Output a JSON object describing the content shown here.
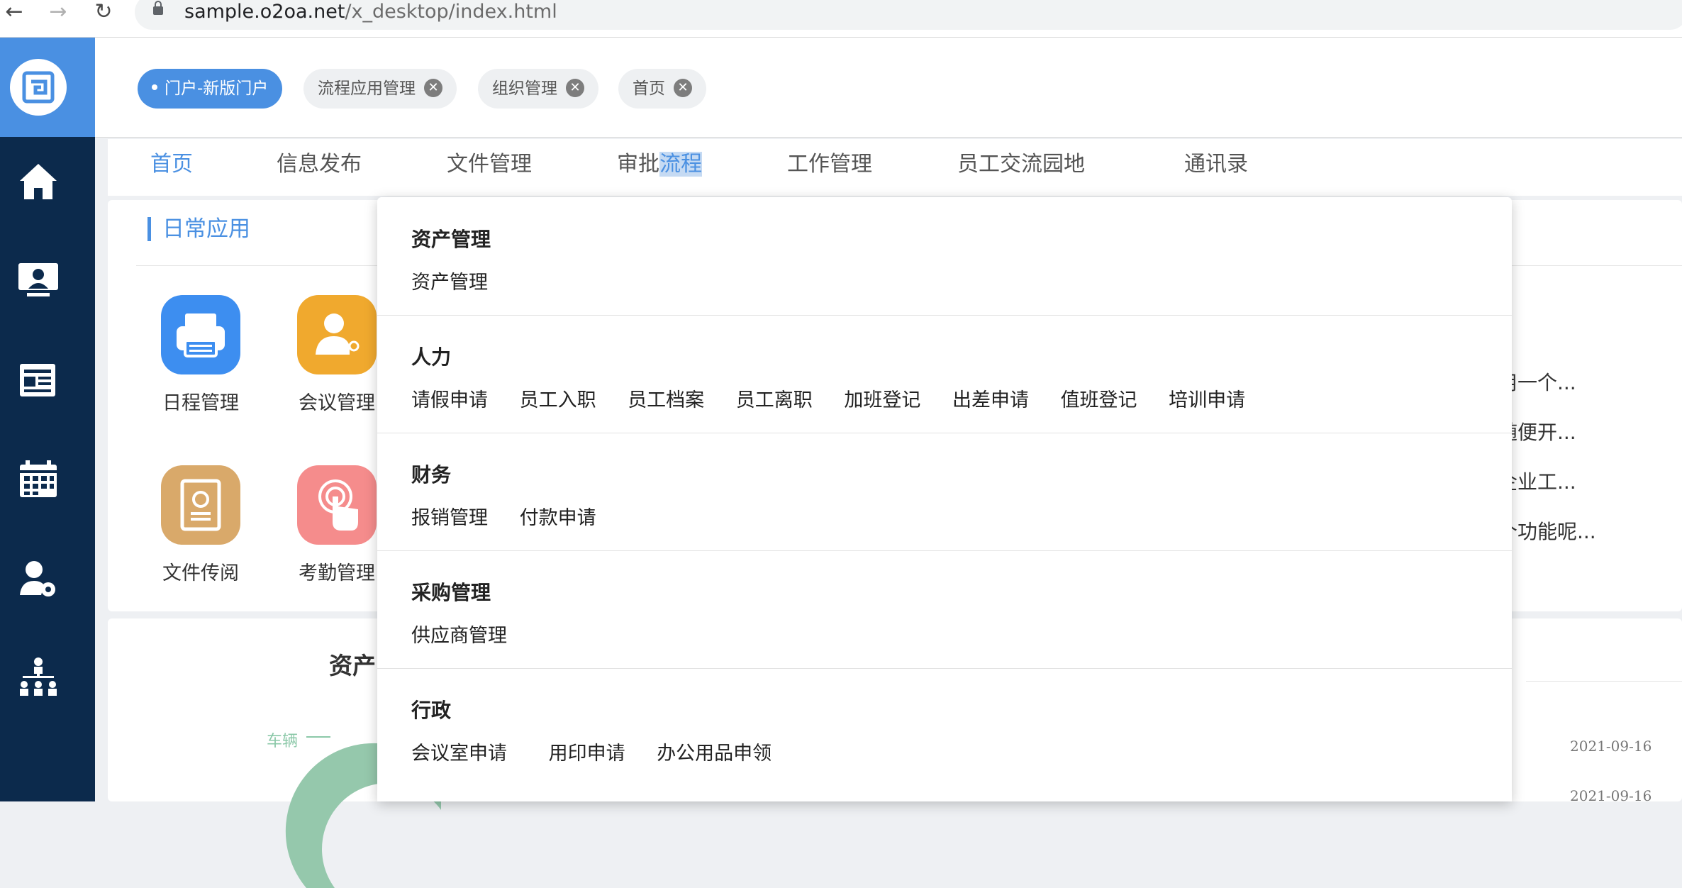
{
  "browser": {
    "back_icon": "←",
    "forward_icon": "→",
    "reload_icon": "↻",
    "url_host": "sample.o2oa.net",
    "url_path": "/x_desktop/index.html"
  },
  "sidebar": {
    "icons": [
      "logo-icon",
      "home-icon",
      "monitor-user-icon",
      "news-icon",
      "calendar-icon",
      "user-settings-icon",
      "org-chart-icon"
    ]
  },
  "tabs": [
    {
      "label": "门户-新版门户",
      "active": true
    },
    {
      "label": "流程应用管理",
      "close": "✕"
    },
    {
      "label": "组织管理",
      "close": "✕"
    },
    {
      "label": "首页",
      "close": "✕"
    }
  ],
  "mainnav": {
    "items": [
      "首页",
      "信息发布",
      "文件管理",
      "审批",
      "流程",
      "工作管理",
      "员工交流园地",
      "通讯录"
    ]
  },
  "daily": {
    "title": "日常应用",
    "apps": [
      {
        "label": "日程管理",
        "icon": "printer-icon",
        "color": "#3d8ef0"
      },
      {
        "label": "会议管理",
        "icon": "meeting-icon",
        "color": "#f0a92e"
      },
      {
        "label": "文件传阅",
        "icon": "certificate-icon",
        "color": "#d9a96a"
      },
      {
        "label": "考勤管理",
        "icon": "touch-icon",
        "color": "#f58c8c"
      }
    ],
    "news": [
      "用一个...",
      "随便开...",
      "企业工...",
      "个功能呢..."
    ]
  },
  "lower": {
    "asset_title": "资产",
    "vehicle_label": "车辆",
    "dates": [
      "2021-09-16",
      "2021-09-16"
    ]
  },
  "dropdown": {
    "sections": [
      {
        "title": "资产管理",
        "items": [
          "资产管理"
        ]
      },
      {
        "title": "人力",
        "items": [
          "请假申请",
          "员工入职",
          "员工档案",
          "员工离职",
          "加班登记",
          "出差申请",
          "值班登记",
          "培训申请"
        ]
      },
      {
        "title": "财务",
        "items": [
          "报销管理",
          "付款申请"
        ]
      },
      {
        "title": "采购管理",
        "items": [
          "供应商管理"
        ]
      },
      {
        "title": "行政",
        "items": [
          "会议室申请",
          "用印申请",
          "办公用品申领"
        ]
      }
    ]
  },
  "colors": {
    "accent": "#4a90e2",
    "sidebar": "#0c2a4c"
  }
}
